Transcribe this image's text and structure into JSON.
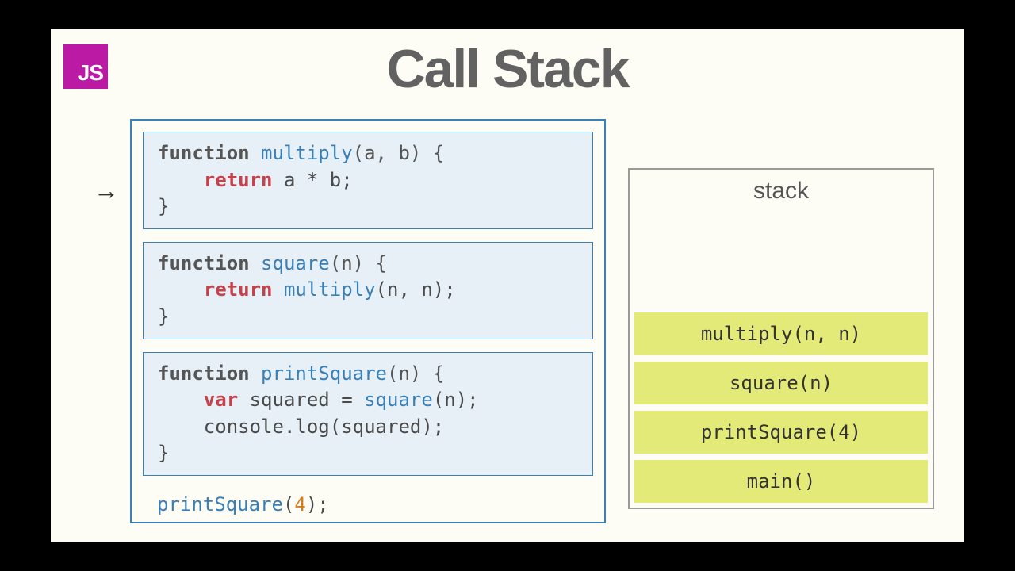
{
  "logo_text": "JS",
  "title": "Call Stack",
  "arrow": "→",
  "code": {
    "multiply": {
      "line1_kw": "function ",
      "line1_fn": "multiply",
      "line1_params": "(a, b) {",
      "line2_indent": "    ",
      "line2_ret": "return",
      "line2_expr": " a * b;",
      "line3": "}"
    },
    "square": {
      "line1_kw": "function ",
      "line1_fn": "square",
      "line1_params": "(n) {",
      "line2_indent": "    ",
      "line2_ret": "return",
      "line2_fn": " multiply",
      "line2_args": "(n, n);",
      "line3": "}"
    },
    "printSquare": {
      "line1_kw": "function ",
      "line1_fn": "printSquare",
      "line1_params": "(n) {",
      "line2_indent": "    ",
      "line2_var": "var",
      "line2_name": " squared = ",
      "line2_fn": "square",
      "line2_args": "(n);",
      "line3_indent": "    ",
      "line3_obj": "console.log",
      "line3_args": "(squared);",
      "line4": "}"
    },
    "call": {
      "fn": "printSquare",
      "open": "(",
      "arg": "4",
      "close": ");"
    }
  },
  "stack": {
    "label": "stack",
    "frames": [
      "multiply(n, n)",
      "square(n)",
      "printSquare(4)",
      "main()"
    ]
  }
}
